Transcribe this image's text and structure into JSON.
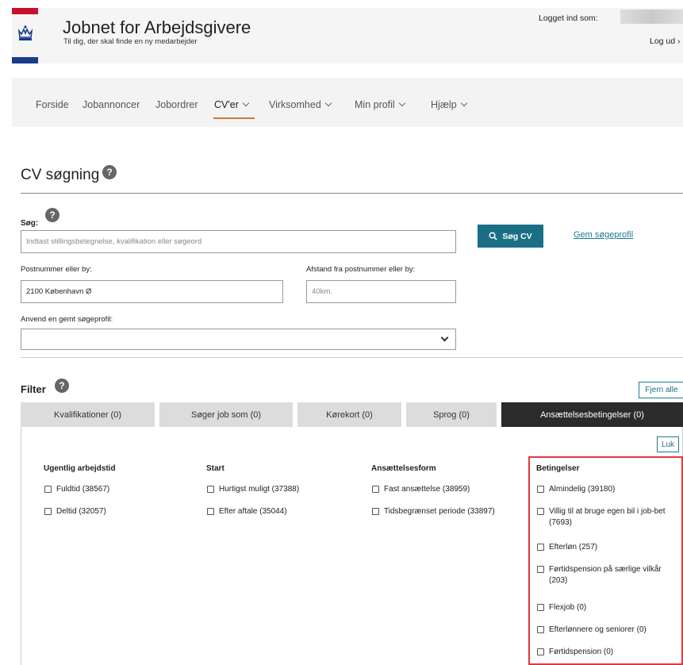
{
  "header": {
    "title": "Jobnet for Arbejdsgivere",
    "subtitle": "Til dig, der skal finde en ny medarbejder",
    "logged_in_label": "Logget ind som:",
    "logout_label": "Log ud ›"
  },
  "nav": {
    "items": [
      {
        "label": "Forside"
      },
      {
        "label": "Jobannoncer"
      },
      {
        "label": "Jobordrer"
      },
      {
        "label": "CV'er"
      },
      {
        "label": "Virksomhed"
      },
      {
        "label": "Min profil"
      },
      {
        "label": "Hjælp"
      }
    ],
    "active": "CV'er"
  },
  "search": {
    "page_title": "CV søgning",
    "help_glyph": "?",
    "sog_label": "Søg:",
    "query_placeholder": "Indtast stillingsbetegnelse, kvalifikation eller søgeord",
    "search_button": "Søg CV",
    "save_link": "Gem søgeprofil",
    "postal_label": "Postnummer eller by:",
    "postal_value": "2100 København Ø",
    "distance_label": "Afstand fra postnummer eller by:",
    "distance_placeholder": "40km.",
    "profile_label": "Anvend en gemt søgeprofil:",
    "profile_value": ""
  },
  "filter": {
    "title": "Filter",
    "remove_all": "Fjern alle",
    "close": "Luk",
    "tabs": [
      {
        "label": "Kvalifikationer (0)"
      },
      {
        "label": "Søger job som (0)"
      },
      {
        "label": "Kørekort (0)"
      },
      {
        "label": "Sprog (0)"
      },
      {
        "label": "Ansættelsesbetingelser (0)"
      }
    ],
    "active_tab": "Ansættelsesbetingelser (0)",
    "columns": {
      "weekly": {
        "title": "Ugentlig arbejdstid",
        "options": [
          "Fuldtid (38567)",
          "Deltid (32057)"
        ]
      },
      "start": {
        "title": "Start",
        "options": [
          "Hurtigst muligt (37388)",
          "Efter aftale (35044)"
        ]
      },
      "form": {
        "title": "Ansættelsesform",
        "options": [
          "Fast ansættelse (38959)",
          "Tidsbegrænset periode (33897)"
        ]
      },
      "conditions": {
        "title": "Betingelser",
        "options": [
          "Almindelig (39180)",
          "Villig til at bruge egen bil i job-bet (7693)",
          "Efterløn (257)",
          "Førtidspension på særlige vilkår (203)",
          "Flexjob (0)",
          "Efterlønnere og seniorer (0)",
          "Førtidspension (0)"
        ]
      }
    }
  },
  "colors": {
    "primary": "#1a6f84",
    "link": "#1a7b94",
    "active_tab": "#2b2b2b",
    "nav_accent": "#c57b3a",
    "highlight": "#e0393e"
  }
}
